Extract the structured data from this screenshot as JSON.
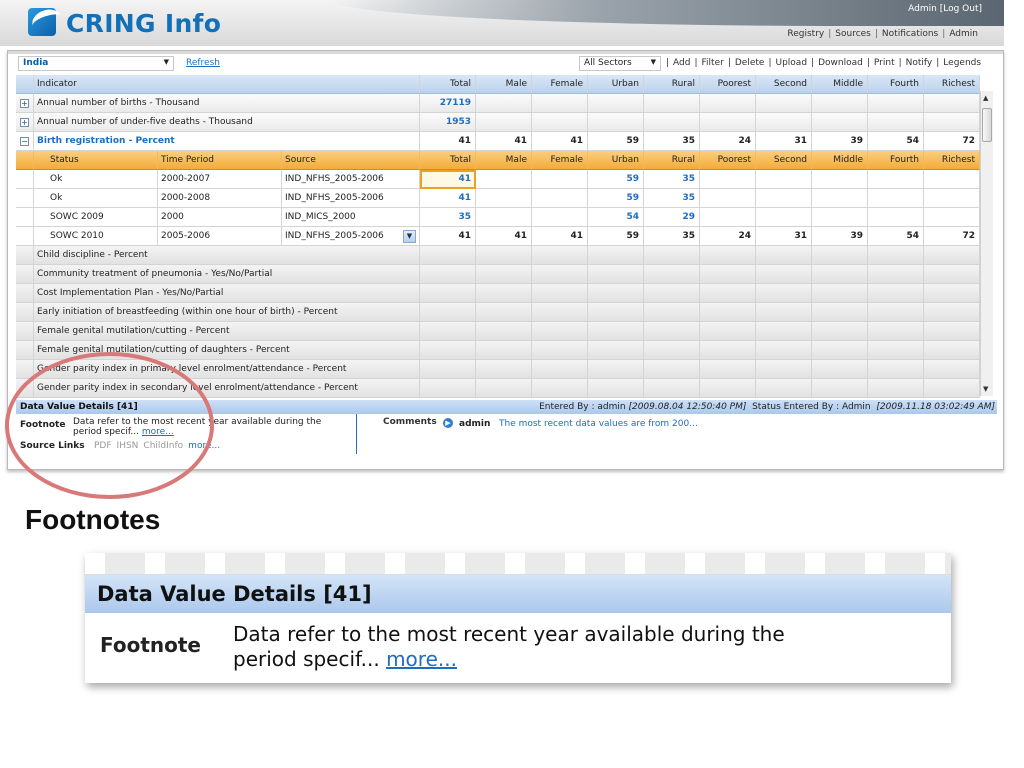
{
  "app": {
    "logo_text": "CRING Info",
    "user_line": "Admin  [Log Out]",
    "nav": [
      "Registry",
      "Sources",
      "Notifications",
      "Admin"
    ]
  },
  "toolbar": {
    "country": "India",
    "refresh": "Refresh",
    "sector": "All Sectors",
    "actions": [
      "Add",
      "Filter",
      "Delete",
      "Upload",
      "Download",
      "Print",
      "Notify",
      "Legends"
    ]
  },
  "grid": {
    "header": [
      "Indicator",
      "Total",
      "Male",
      "Female",
      "Urban",
      "Rural",
      "Poorest",
      "Second",
      "Middle",
      "Fourth",
      "Richest"
    ],
    "collapsed_rows": [
      {
        "label": "Annual number of births - Thousand",
        "total": "27119"
      },
      {
        "label": "Annual number of under-five deaths - Thousand",
        "total": "1953"
      }
    ],
    "open_row": {
      "label": "Birth registration - Percent",
      "values": [
        "41",
        "41",
        "41",
        "59",
        "35",
        "24",
        "31",
        "39",
        "54",
        "72"
      ]
    },
    "sub_header": [
      "Status",
      "Time Period",
      "Source",
      "Total",
      "Male",
      "Female",
      "Urban",
      "Rural",
      "Poorest",
      "Second",
      "Middle",
      "Fourth",
      "Richest"
    ],
    "sub_rows": [
      {
        "status": "Ok",
        "period": "2000-2007",
        "source": "IND_NFHS_2005-2006",
        "values": [
          "41",
          "",
          "",
          "59",
          "35",
          "",
          "",
          "",
          "",
          ""
        ]
      },
      {
        "status": "Ok",
        "period": "2000-2008",
        "source": "IND_NFHS_2005-2006",
        "values": [
          "41",
          "",
          "",
          "59",
          "35",
          "",
          "",
          "",
          "",
          ""
        ]
      },
      {
        "status": "SOWC 2009",
        "period": "2000",
        "source": "IND_MICS_2000",
        "values": [
          "35",
          "",
          "",
          "54",
          "29",
          "",
          "",
          "",
          "",
          ""
        ]
      },
      {
        "status": "SOWC 2010",
        "period": "2005-2006",
        "source": "IND_NFHS_2005-2006",
        "values": [
          "41",
          "41",
          "41",
          "59",
          "35",
          "24",
          "31",
          "39",
          "54",
          "72"
        ]
      }
    ],
    "other_indicators": [
      "Child discipline - Percent",
      "Community treatment of pneumonia - Yes/No/Partial",
      "Cost Implementation Plan - Yes/No/Partial",
      "Early initiation of breastfeeding (within one hour of birth) - Percent",
      "Female genital mutilation/cutting - Percent",
      "Female genital mutilation/cutting of daughters - Percent",
      "Gender parity index in primary level enrolment/attendance - Percent",
      "Gender parity index in secondary level enrolment/attendance - Percent"
    ]
  },
  "details": {
    "title": "Data Value Details  [41]",
    "entered_by_label": "Entered By  :  admin",
    "entered_at": "[2009.08.04 12:50:40 PM]",
    "status_by_label": "Status Entered By  :  Admin",
    "status_at": "[2009.11.18 03:02:49 AM]",
    "footnote_label": "Footnote",
    "footnote_text": "Data refer to the most recent year available during the period specif...",
    "more": "more...",
    "source_links_label": "Source Links",
    "source_links": [
      "PDF",
      "IHSN",
      "ChildInfo",
      "more..."
    ],
    "comments_label": "Comments",
    "comment_user": "admin",
    "comment_text": "The most recent data values are from 200..."
  },
  "annotation": {
    "caption": "Footnotes",
    "circle_color": "#d97878"
  },
  "zoom": {
    "title": "Data Value Details  [41]",
    "footnote_label": "Footnote",
    "footnote_line1": "Data refer to the most recent year available during the",
    "footnote_line2": "period specif...",
    "more": "more..."
  },
  "colors": {
    "accent_blue": "#1d6dc1",
    "header_blue": "#b9d0ec",
    "sub_header_orange": "#f3a935"
  }
}
